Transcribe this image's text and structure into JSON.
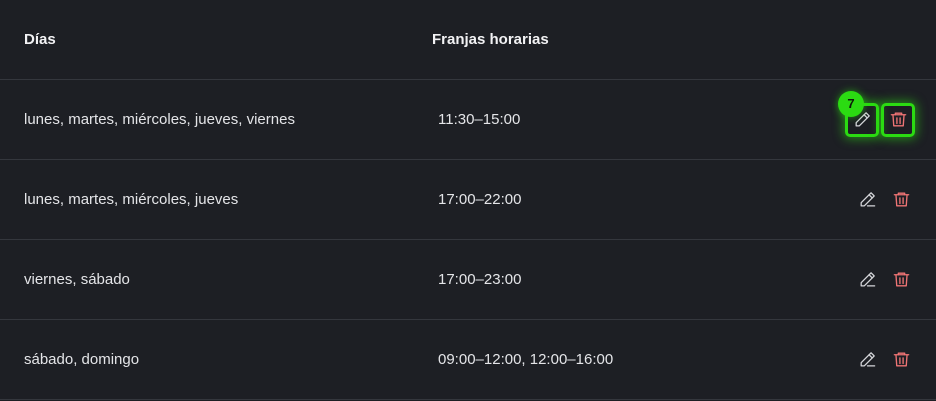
{
  "table": {
    "headers": {
      "days": "Días",
      "time_slots": "Franjas horarias"
    },
    "rows": [
      {
        "days": "lunes, martes, miércoles, jueves, viernes",
        "time_slots": "11:30–15:00"
      },
      {
        "days": "lunes, martes, miércoles, jueves",
        "time_slots": "17:00–22:00"
      },
      {
        "days": "viernes, sábado",
        "time_slots": "17:00–23:00"
      },
      {
        "days": "sábado, domingo",
        "time_slots": "09:00–12:00, 12:00–16:00"
      }
    ]
  },
  "icons": {
    "edit": "pencil-icon",
    "delete": "trash-icon"
  },
  "highlight": {
    "badge_label": "7",
    "color": "#2bdb12"
  },
  "colors": {
    "background": "#1d1f24",
    "divider": "#34373d",
    "delete_icon": "#ee7474"
  }
}
